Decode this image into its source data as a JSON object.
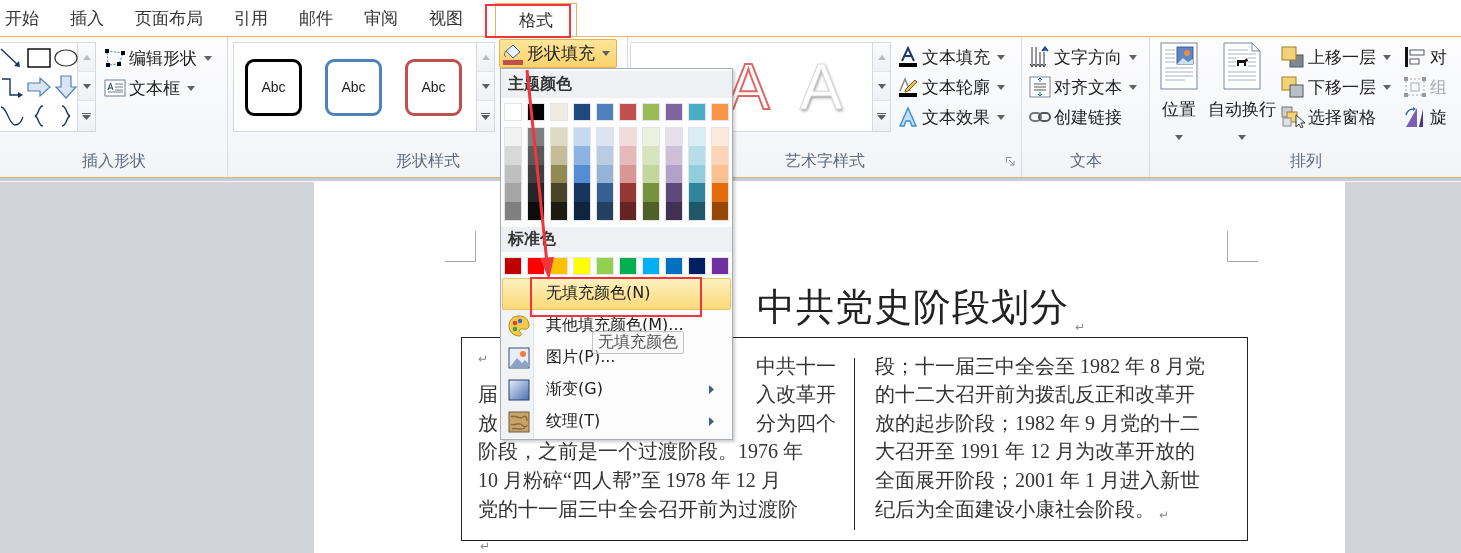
{
  "tabs": [
    {
      "label": "开始",
      "selected": false
    },
    {
      "label": "插入",
      "selected": false
    },
    {
      "label": "页面布局",
      "selected": false
    },
    {
      "label": "引用",
      "selected": false
    },
    {
      "label": "邮件",
      "selected": false
    },
    {
      "label": "审阅",
      "selected": false
    },
    {
      "label": "视图",
      "selected": false
    },
    {
      "label": "格式",
      "selected": true
    }
  ],
  "ribbon": {
    "insert_shapes": {
      "buttons": [
        {
          "label": "编辑形状",
          "dropdown": true
        },
        {
          "label": "文本框",
          "dropdown": true
        }
      ],
      "group_label": "插入形状"
    },
    "shape_styles": {
      "styles": [
        {
          "label": "Abc",
          "color": "#000000"
        },
        {
          "label": "Abc",
          "color": "#4f81bd"
        },
        {
          "label": "Abc",
          "color": "#c0504d"
        }
      ],
      "fill_button": {
        "label": "形状填充",
        "pressed": true,
        "color": "#c0504d"
      },
      "group_label": "形状样式"
    },
    "wordart_styles": {
      "styles": [
        {
          "label": "A",
          "kind": "outline"
        },
        {
          "label": "A",
          "kind": "shadow"
        }
      ],
      "buttons": [
        {
          "label": "文本填充",
          "dropdown": true
        },
        {
          "label": "文本轮廓",
          "dropdown": true
        },
        {
          "label": "文本效果",
          "dropdown": true
        }
      ],
      "group_label": "艺术字样式"
    },
    "text": {
      "buttons": [
        {
          "label": "文字方向",
          "dropdown": true
        },
        {
          "label": "对齐文本",
          "dropdown": true
        },
        {
          "label": "创建链接",
          "dropdown": false
        }
      ],
      "group_label": "文本"
    },
    "arrange": {
      "large_buttons": [
        {
          "label": "位置"
        },
        {
          "label": "自动换行"
        }
      ],
      "buttons": [
        {
          "label": "上移一层",
          "dropdown": true
        },
        {
          "label": "下移一层",
          "dropdown": true
        },
        {
          "label": "选择窗格",
          "dropdown": false
        }
      ],
      "cut_buttons": [
        {
          "label": "对",
          "disabled": false
        },
        {
          "label": "组",
          "disabled": true
        },
        {
          "label": "旋",
          "disabled": false
        }
      ],
      "group_label": "排列"
    }
  },
  "fill_menu": {
    "theme_header": "主题颜色",
    "theme_colors": [
      {
        "color": "#ffffff"
      },
      {
        "color": "#000000"
      },
      {
        "color": "#eeece1"
      },
      {
        "color": "#1f497d"
      },
      {
        "color": "#4f81bd"
      },
      {
        "color": "#c0504d"
      },
      {
        "color": "#9bbb59"
      },
      {
        "color": "#8064a2"
      },
      {
        "color": "#4bacc6"
      },
      {
        "color": "#f79646"
      }
    ],
    "shade_rows": [
      {
        "swatches": [
          {
            "color": "#f2f2f2"
          },
          {
            "color": "#7f7f7f"
          },
          {
            "color": "#ddd9c3"
          },
          {
            "color": "#c6d9f0"
          },
          {
            "color": "#dbe5f1"
          },
          {
            "color": "#f2dcdb"
          },
          {
            "color": "#ebf1dd"
          },
          {
            "color": "#e5e0ec"
          },
          {
            "color": "#dbeef3"
          },
          {
            "color": "#fdeada"
          }
        ]
      },
      {
        "swatches": [
          {
            "color": "#d8d8d8"
          },
          {
            "color": "#595959"
          },
          {
            "color": "#c4bd97"
          },
          {
            "color": "#8db3e2"
          },
          {
            "color": "#b8cce4"
          },
          {
            "color": "#e5b9b7"
          },
          {
            "color": "#d7e3bc"
          },
          {
            "color": "#ccc1d9"
          },
          {
            "color": "#b7dde8"
          },
          {
            "color": "#fbd5b5"
          }
        ]
      },
      {
        "swatches": [
          {
            "color": "#bfbfbf"
          },
          {
            "color": "#3f3f3f"
          },
          {
            "color": "#938953"
          },
          {
            "color": "#548dd4"
          },
          {
            "color": "#95b3d7"
          },
          {
            "color": "#d99694"
          },
          {
            "color": "#c3d69b"
          },
          {
            "color": "#b2a2c7"
          },
          {
            "color": "#92cddc"
          },
          {
            "color": "#fac08f"
          }
        ]
      },
      {
        "swatches": [
          {
            "color": "#a5a5a5"
          },
          {
            "color": "#262626"
          },
          {
            "color": "#494429"
          },
          {
            "color": "#17365d"
          },
          {
            "color": "#366092"
          },
          {
            "color": "#953734"
          },
          {
            "color": "#76923c"
          },
          {
            "color": "#5f497a"
          },
          {
            "color": "#31859b"
          },
          {
            "color": "#e36c09"
          }
        ]
      },
      {
        "swatches": [
          {
            "color": "#7f7f7f"
          },
          {
            "color": "#0c0c0c"
          },
          {
            "color": "#1d1b10"
          },
          {
            "color": "#0f243e"
          },
          {
            "color": "#244061"
          },
          {
            "color": "#632423"
          },
          {
            "color": "#4f6128"
          },
          {
            "color": "#3f3151"
          },
          {
            "color": "#205867"
          },
          {
            "color": "#974806"
          }
        ]
      }
    ],
    "standard_header": "标准色",
    "standard_colors": [
      {
        "color": "#c00000"
      },
      {
        "color": "#ff0000"
      },
      {
        "color": "#ffc000"
      },
      {
        "color": "#ffff00"
      },
      {
        "color": "#92d050"
      },
      {
        "color": "#00b050"
      },
      {
        "color": "#00b0f0"
      },
      {
        "color": "#0070c0"
      },
      {
        "color": "#002060"
      },
      {
        "color": "#7030a0"
      }
    ],
    "items": [
      {
        "label": "无填充颜色(N)",
        "kind": "none",
        "highlighted": true,
        "submenu": false
      },
      {
        "label": "其他填充颜色(M)...",
        "kind": "palette",
        "highlighted": false,
        "submenu": false
      },
      {
        "label": "图片(P)...",
        "kind": "picture",
        "highlighted": false,
        "submenu": false
      },
      {
        "label": "渐变(G)",
        "kind": "gradient",
        "highlighted": false,
        "submenu": true
      },
      {
        "label": "纹理(T)",
        "kind": "texture",
        "highlighted": false,
        "submenu": true
      }
    ]
  },
  "tooltip": "无填充颜色",
  "document": {
    "title": "中共党史阶段划分",
    "title_mark": "↵",
    "left_lines": [
      {
        "start": "↵",
        "end": "中共十一"
      },
      {
        "start": "届",
        "end": "入改革开"
      },
      {
        "start": "放",
        "end": "分为四个"
      },
      {
        "text": "阶段，之前是一个过渡阶段。1976 年"
      },
      {
        "text": "10 月粉碎“四人帮”至 1978 年 12 月"
      },
      {
        "text": "党的十一届三中全会召开前为过渡阶"
      }
    ],
    "right_lines": [
      "段；十一届三中全会至 1982 年 8 月党",
      "的十二大召开前为拨乱反正和改革开",
      "放的起步阶段；1982 年 9 月党的十二",
      "大召开至 1991 年 12 月为改革开放的",
      "全面展开阶段；2001 年 1 月进入新世",
      "纪后为全面建设小康社会阶段。"
    ],
    "end_mark": "↵",
    "after_mark": "↵"
  }
}
